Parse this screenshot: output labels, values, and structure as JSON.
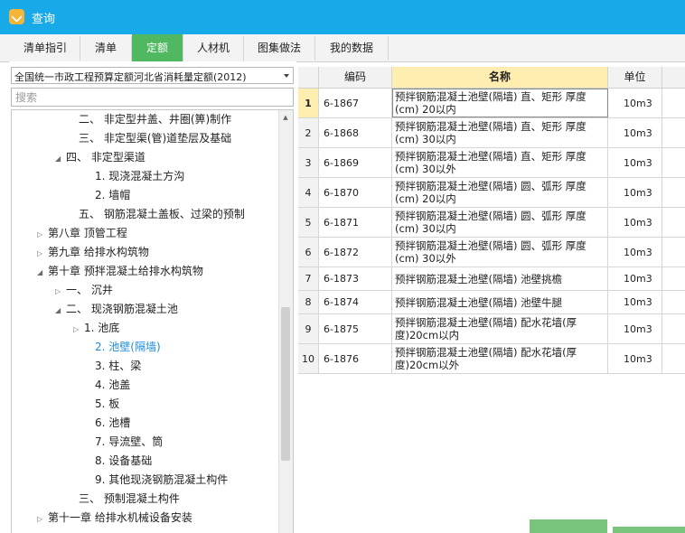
{
  "window": {
    "title": "查询"
  },
  "tabs": [
    {
      "label": "清单指引"
    },
    {
      "label": "清单"
    },
    {
      "label": "定额"
    },
    {
      "label": "人材机"
    },
    {
      "label": "图集做法"
    },
    {
      "label": "我的数据"
    }
  ],
  "active_tab": "定额",
  "left_panel": {
    "dropdown_value": "全国统一市政工程预算定额河北省消耗量定额(2012)",
    "search_placeholder": "搜索",
    "tree": [
      {
        "toggle": "",
        "label": "二、  非定型井盖、井圈(箅)制作"
      },
      {
        "toggle": "",
        "label": "三、  非定型渠(管)道垫层及基础"
      },
      {
        "toggle": "◢",
        "label": "四、  非定型渠道"
      },
      {
        "toggle": "",
        "label": "1.  现浇混凝土方沟"
      },
      {
        "toggle": "",
        "label": "2.  墙帽"
      },
      {
        "toggle": "",
        "label": "五、  钢筋混凝土盖板、过梁的预制"
      },
      {
        "toggle": "▷",
        "label": "第八章  顶管工程"
      },
      {
        "toggle": "▷",
        "label": "第九章  给排水构筑物"
      },
      {
        "toggle": "◢",
        "label": "第十章  预拌混凝土给排水构筑物"
      },
      {
        "toggle": "▷",
        "label": "一、  沉井"
      },
      {
        "toggle": "◢",
        "label": "二、  现浇钢筋混凝土池"
      },
      {
        "toggle": "▷",
        "label": "1.  池底"
      },
      {
        "toggle": "",
        "label": "2.  池壁(隔墙)"
      },
      {
        "toggle": "",
        "label": "3.  柱、梁"
      },
      {
        "toggle": "",
        "label": "4.  池盖"
      },
      {
        "toggle": "",
        "label": "5.  板"
      },
      {
        "toggle": "",
        "label": "6.  池槽"
      },
      {
        "toggle": "",
        "label": "7.  导流壁、筒"
      },
      {
        "toggle": "",
        "label": "8.  设备基础"
      },
      {
        "toggle": "",
        "label": "9.  其他现浇钢筋混凝土构件"
      },
      {
        "toggle": "",
        "label": "三、  预制混凝土构件"
      },
      {
        "toggle": "▷",
        "label": "第十一章  给排水机械设备安装"
      }
    ]
  },
  "table": {
    "columns": [
      "编码",
      "名称",
      "单位"
    ],
    "rows": [
      {
        "index": "1",
        "code": "6-1867",
        "name": "预拌钢筋混凝土池壁(隔墙) 直、矩形 厚度(cm) 20以内",
        "unit": "10m3"
      },
      {
        "index": "2",
        "code": "6-1868",
        "name": "预拌钢筋混凝土池壁(隔墙) 直、矩形 厚度(cm) 30以内",
        "unit": "10m3"
      },
      {
        "index": "3",
        "code": "6-1869",
        "name": "预拌钢筋混凝土池壁(隔墙) 直、矩形 厚度(cm) 30以外",
        "unit": "10m3"
      },
      {
        "index": "4",
        "code": "6-1870",
        "name": "预拌钢筋混凝土池壁(隔墙) 圆、弧形 厚度(cm) 20以内",
        "unit": "10m3"
      },
      {
        "index": "5",
        "code": "6-1871",
        "name": "预拌钢筋混凝土池壁(隔墙) 圆、弧形 厚度(cm) 30以内",
        "unit": "10m3"
      },
      {
        "index": "6",
        "code": "6-1872",
        "name": "预拌钢筋混凝土池壁(隔墙) 圆、弧形 厚度(cm) 30以外",
        "unit": "10m3"
      },
      {
        "index": "7",
        "code": "6-1873",
        "name": "预拌钢筋混凝土池壁(隔墙) 池壁挑檐",
        "unit": "10m3"
      },
      {
        "index": "8",
        "code": "6-1874",
        "name": "预拌钢筋混凝土池壁(隔墙) 池壁牛腿",
        "unit": "10m3"
      },
      {
        "index": "9",
        "code": "6-1875",
        "name": "预拌钢筋混凝土池壁(隔墙) 配水花墙(厚度)20cm以内",
        "unit": "10m3"
      },
      {
        "index": "10",
        "code": "6-1876",
        "name": "预拌钢筋混凝土池壁(隔墙) 配水花墙(厚度)20cm以外",
        "unit": "10m3"
      }
    ]
  },
  "colors": {
    "titlebar": "#18a9e8",
    "active_tab": "#4fb860",
    "header_highlight": "#ffeeb0",
    "tree_selected": "#1e8bdb"
  }
}
